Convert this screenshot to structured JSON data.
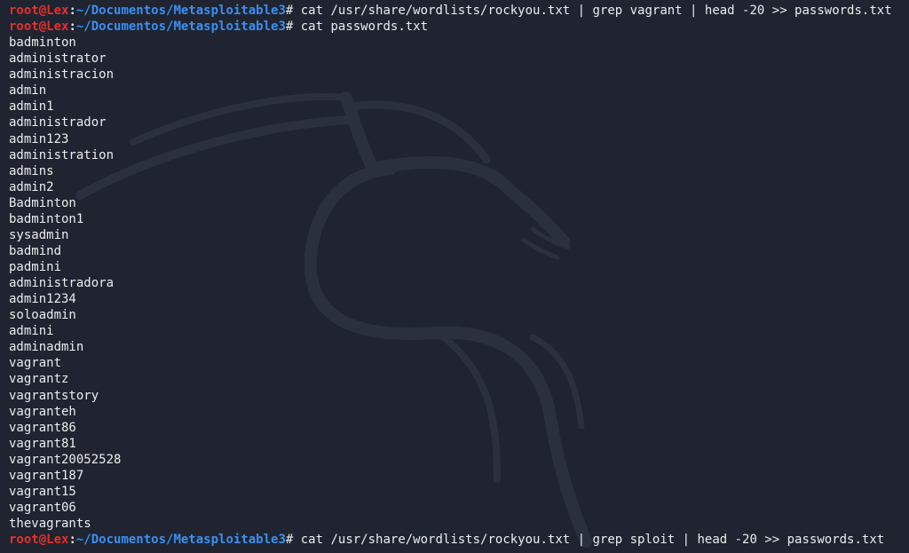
{
  "prompt": {
    "user_host": "root@Lex",
    "separator": ":",
    "path": "~/Documentos/Metasploitable3",
    "symbol": "# "
  },
  "commands": [
    "cat /usr/share/wordlists/rockyou.txt | grep vagrant | head -20 >> passwords.txt",
    "cat passwords.txt",
    "cat /usr/share/wordlists/rockyou.txt | grep sploit | head -20 >> passwords.txt"
  ],
  "output": [
    "badminton",
    "administrator",
    "administracion",
    "admin",
    "admin1",
    "administrador",
    "admin123",
    "administration",
    "admins",
    "admin2",
    "Badminton",
    "badminton1",
    "sysadmin",
    "badmind",
    "padmini",
    "administradora",
    "admin1234",
    "soloadmin",
    "admini",
    "adminadmin",
    "vagrant",
    "vagrantz",
    "vagrantstory",
    "vagranteh",
    "vagrant86",
    "vagrant81",
    "vagrant20052528",
    "vagrant187",
    "vagrant15",
    "vagrant06",
    "thevagrants"
  ],
  "colors": {
    "background": "#1f2430",
    "user": "#e5302b",
    "path": "#3c8ff0",
    "text": "#e8e8e8"
  },
  "watermark_icon": "kali-dragon-icon"
}
